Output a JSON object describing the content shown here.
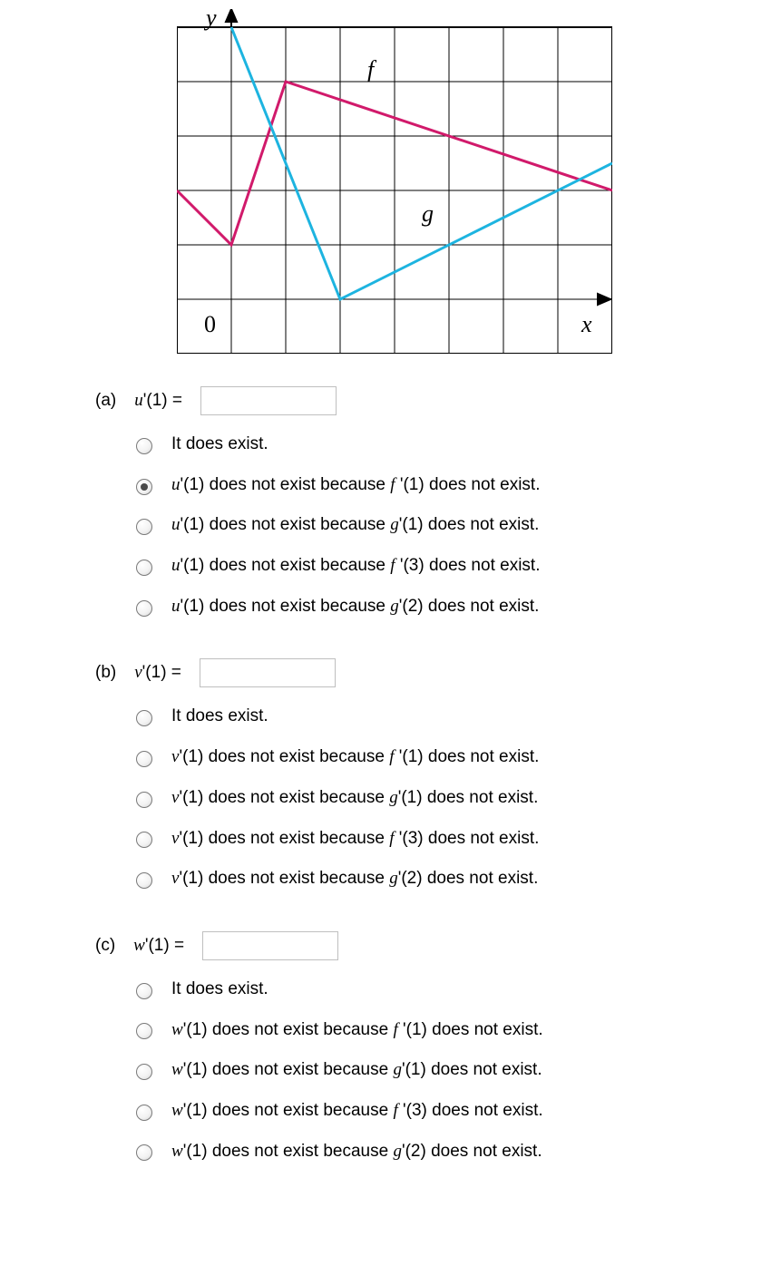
{
  "chart_data": {
    "type": "line",
    "xlabel": "x",
    "ylabel": "y",
    "xlim": [
      -1,
      7
    ],
    "ylim": [
      -1,
      5
    ],
    "grid": true,
    "series": [
      {
        "name": "f",
        "color": "#d11a6b",
        "points": [
          {
            "x": -1,
            "y": 2
          },
          {
            "x": 0,
            "y": 1
          },
          {
            "x": 1,
            "y": 4
          },
          {
            "x": 7,
            "y": 2
          }
        ]
      },
      {
        "name": "g",
        "color": "#1db4e0",
        "points": [
          {
            "x": 0,
            "y": 5
          },
          {
            "x": 2,
            "y": 0
          },
          {
            "x": 7,
            "y": 2.5
          }
        ]
      }
    ],
    "annotations": [
      {
        "text": "y",
        "x": -0.6,
        "y": 5.4
      },
      {
        "text": "f",
        "x": 1.6,
        "y": 4.4
      },
      {
        "text": "g",
        "x": 3.5,
        "y": 1.6
      },
      {
        "text": "0",
        "x": -0.6,
        "y": -0.6
      },
      {
        "text": "x",
        "x": 6.5,
        "y": -0.6
      }
    ]
  },
  "labels": {
    "y": "y",
    "f": "f",
    "g": "g",
    "zero": "0",
    "x": "x"
  },
  "parts": {
    "a": {
      "label": "(a)",
      "var": "u",
      "eq": "'(1) =",
      "options": [
        "It does exist.",
        "u'(1) does not exist because f '(1) does not exist.",
        "u'(1) does not exist because g'(1) does not exist.",
        "u'(1) does not exist because f '(3) does not exist.",
        "u'(1) does not exist because g'(2) does not exist."
      ],
      "selected": 1
    },
    "b": {
      "label": "(b)",
      "var": "v",
      "eq": "'(1) =",
      "options": [
        "It does exist.",
        "v'(1) does not exist because f '(1) does not exist.",
        "v'(1) does not exist because g'(1) does not exist.",
        "v'(1) does not exist because f '(3) does not exist.",
        "v'(1) does not exist because g'(2) does not exist."
      ],
      "selected": -1
    },
    "c": {
      "label": "(c)",
      "var": "w",
      "eq": "'(1) =",
      "options": [
        "It does exist.",
        "w'(1) does not exist because f '(1) does not exist.",
        "w'(1) does not exist because g'(1) does not exist.",
        "w'(1) does not exist because f '(3) does not exist.",
        "w'(1) does not exist because g'(2) does not exist."
      ],
      "selected": -1
    }
  }
}
